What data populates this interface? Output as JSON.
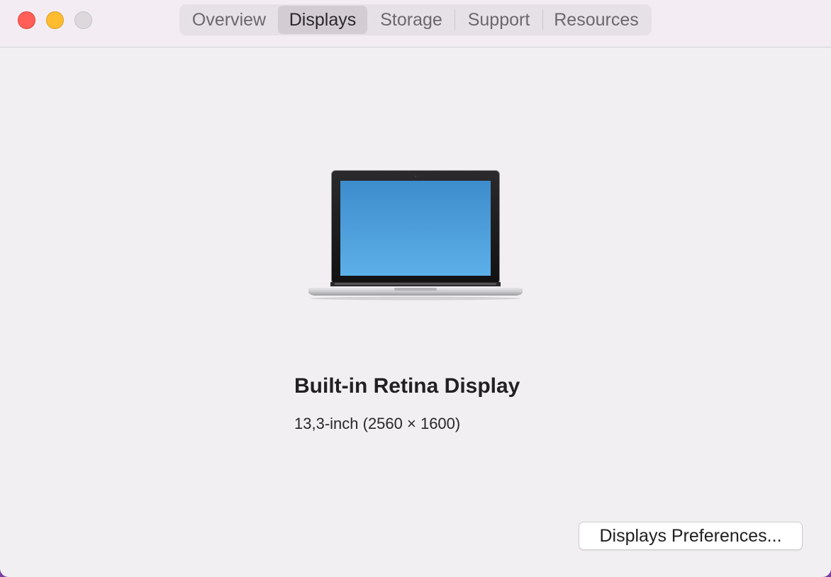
{
  "window": {
    "controls": {
      "close": "close",
      "minimize": "minimize",
      "zoom": "zoom"
    }
  },
  "tabs": [
    {
      "label": "Overview",
      "selected": false
    },
    {
      "label": "Displays",
      "selected": true
    },
    {
      "label": "Storage",
      "selected": false
    },
    {
      "label": "Support",
      "selected": false
    },
    {
      "label": "Resources",
      "selected": false
    }
  ],
  "display": {
    "icon": "macbook-pro-icon",
    "name": "Built-in Retina Display",
    "spec": "13,3-inch (2560 × 1600)"
  },
  "actions": {
    "preferences_label": "Displays Preferences..."
  },
  "colors": {
    "close": "#ff5f57",
    "minimize": "#febc2e",
    "zoom_inactive": "#dcd8dc",
    "screen_top": "#3d8ccc",
    "screen_bottom": "#5cb0e8"
  }
}
